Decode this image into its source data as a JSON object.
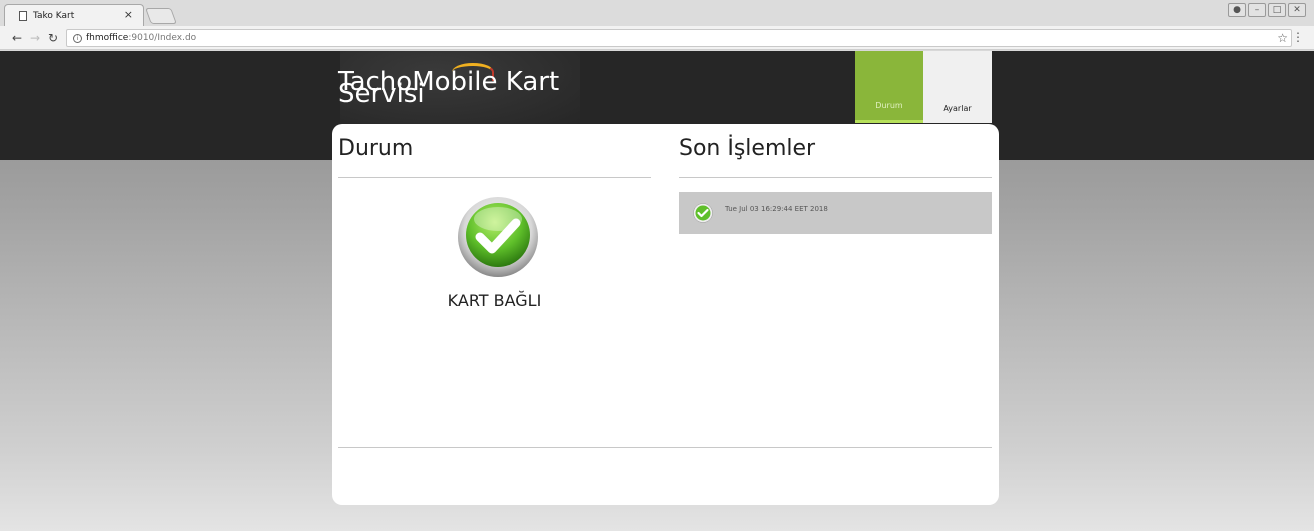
{
  "browser": {
    "tab_title": "Tako Kart",
    "tab_close": "×",
    "url_host": "fhmoffice",
    "url_rest": ":9010/Index.do"
  },
  "app": {
    "title_line1": "TachoMobile Kart",
    "title_line2": "Servisi",
    "nav": [
      {
        "label": "Durum",
        "active": true,
        "color": "#8ab63a"
      },
      {
        "label": "Ayarlar",
        "active": false
      }
    ]
  },
  "status": {
    "heading": "Durum",
    "state_text": "KART BAĞLI",
    "icon": "check-circle-icon",
    "color": "#5fbf2a"
  },
  "recent": {
    "heading": "Son İşlemler",
    "items": [
      {
        "icon": "check-circle-icon",
        "text": "Tue Jul 03 16:29:44 EET 2018"
      }
    ]
  }
}
